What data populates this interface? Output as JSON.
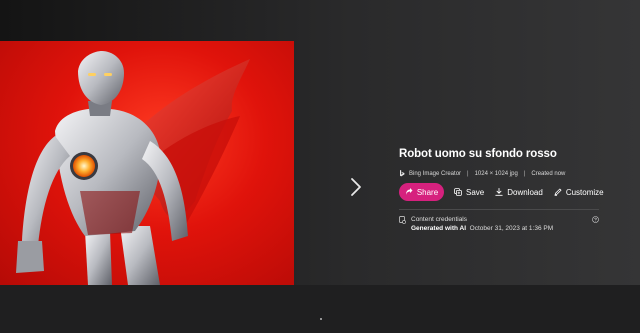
{
  "image": {
    "alt": "Robot uomo su sfondo rosso"
  },
  "details": {
    "title": "Robot uomo su sfondo rosso",
    "source": "Bing Image Creator",
    "dimensions": "1024 × 1024 jpg",
    "created": "Created now"
  },
  "actions": {
    "share": "Share",
    "save": "Save",
    "download": "Download",
    "customize": "Customize"
  },
  "credentials": {
    "title": "Content credentials",
    "generated": "Generated with AI",
    "date": "October 31, 2023 at 1:36 PM"
  },
  "colors": {
    "share_accent": "#d6217e",
    "background_red": "#e0130b"
  },
  "icons": [
    "bing-icon",
    "chevron-right-icon",
    "share-icon",
    "save-icon",
    "download-icon",
    "customize-icon",
    "credentials-icon",
    "info-icon"
  ]
}
